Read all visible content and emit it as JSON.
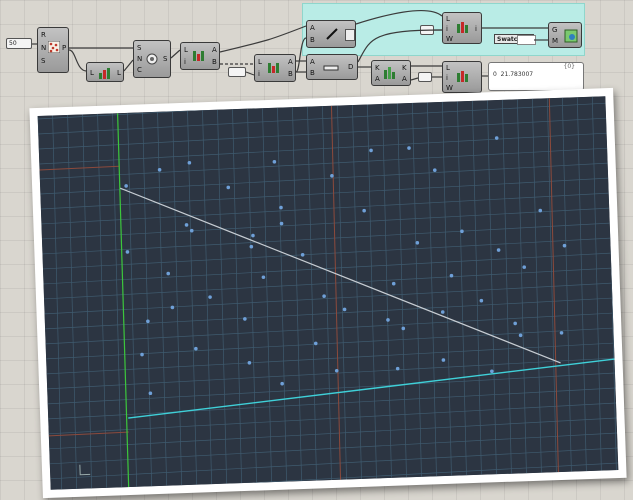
{
  "canvas": {
    "slider": {
      "value": "50"
    },
    "components": {
      "populate": {
        "inputs": [
          "R",
          "N",
          "S"
        ],
        "output": "P"
      },
      "list_length": {
        "inputs": [
          "L"
        ],
        "output": "L"
      },
      "sort": {
        "inputs": [
          "S",
          "N",
          "C"
        ],
        "output": "S"
      },
      "list_item_1": {
        "inputs": [
          "L",
          "i"
        ],
        "outputs": [
          "A",
          "B"
        ]
      },
      "panel_one": {
        "value": "1"
      },
      "list_item_2": {
        "inputs": [
          "L",
          "i"
        ],
        "outputs": [
          "A",
          "B"
        ]
      },
      "line": {
        "inputs": [
          "A",
          "B"
        ],
        "output": ""
      },
      "distance": {
        "inputs": [
          "A",
          "B"
        ],
        "output": "D"
      },
      "max": {
        "inputs": [
          "K",
          "A"
        ],
        "outputs": [
          "K",
          "A"
        ]
      },
      "weave_top": {
        "inputs": [
          "L",
          "i",
          "W"
        ],
        "output": "i"
      },
      "weave_bottom": {
        "inputs": [
          "L",
          "i",
          "W"
        ],
        "output": ""
      },
      "neg_one_top": {
        "value": "-1"
      },
      "neg_one_bottom": {
        "value": "-1"
      },
      "preview": {
        "inputs": [
          "G",
          "M"
        ]
      }
    },
    "swatch": {
      "label": "Swatch"
    },
    "panel": {
      "header": "{0}",
      "row_index": "0",
      "row_value": "21.783007"
    }
  },
  "viewport": {
    "colors": {
      "background": "#2c3542",
      "grid_minor": "#3f5b6f",
      "grid_major": "#4b6f86",
      "axis_x": "#3fd0d8",
      "axis_y": "#3cc63c",
      "red_lines": "#8c4a3c",
      "points": "#6fa0d8",
      "line": "#c6ccd2"
    }
  }
}
